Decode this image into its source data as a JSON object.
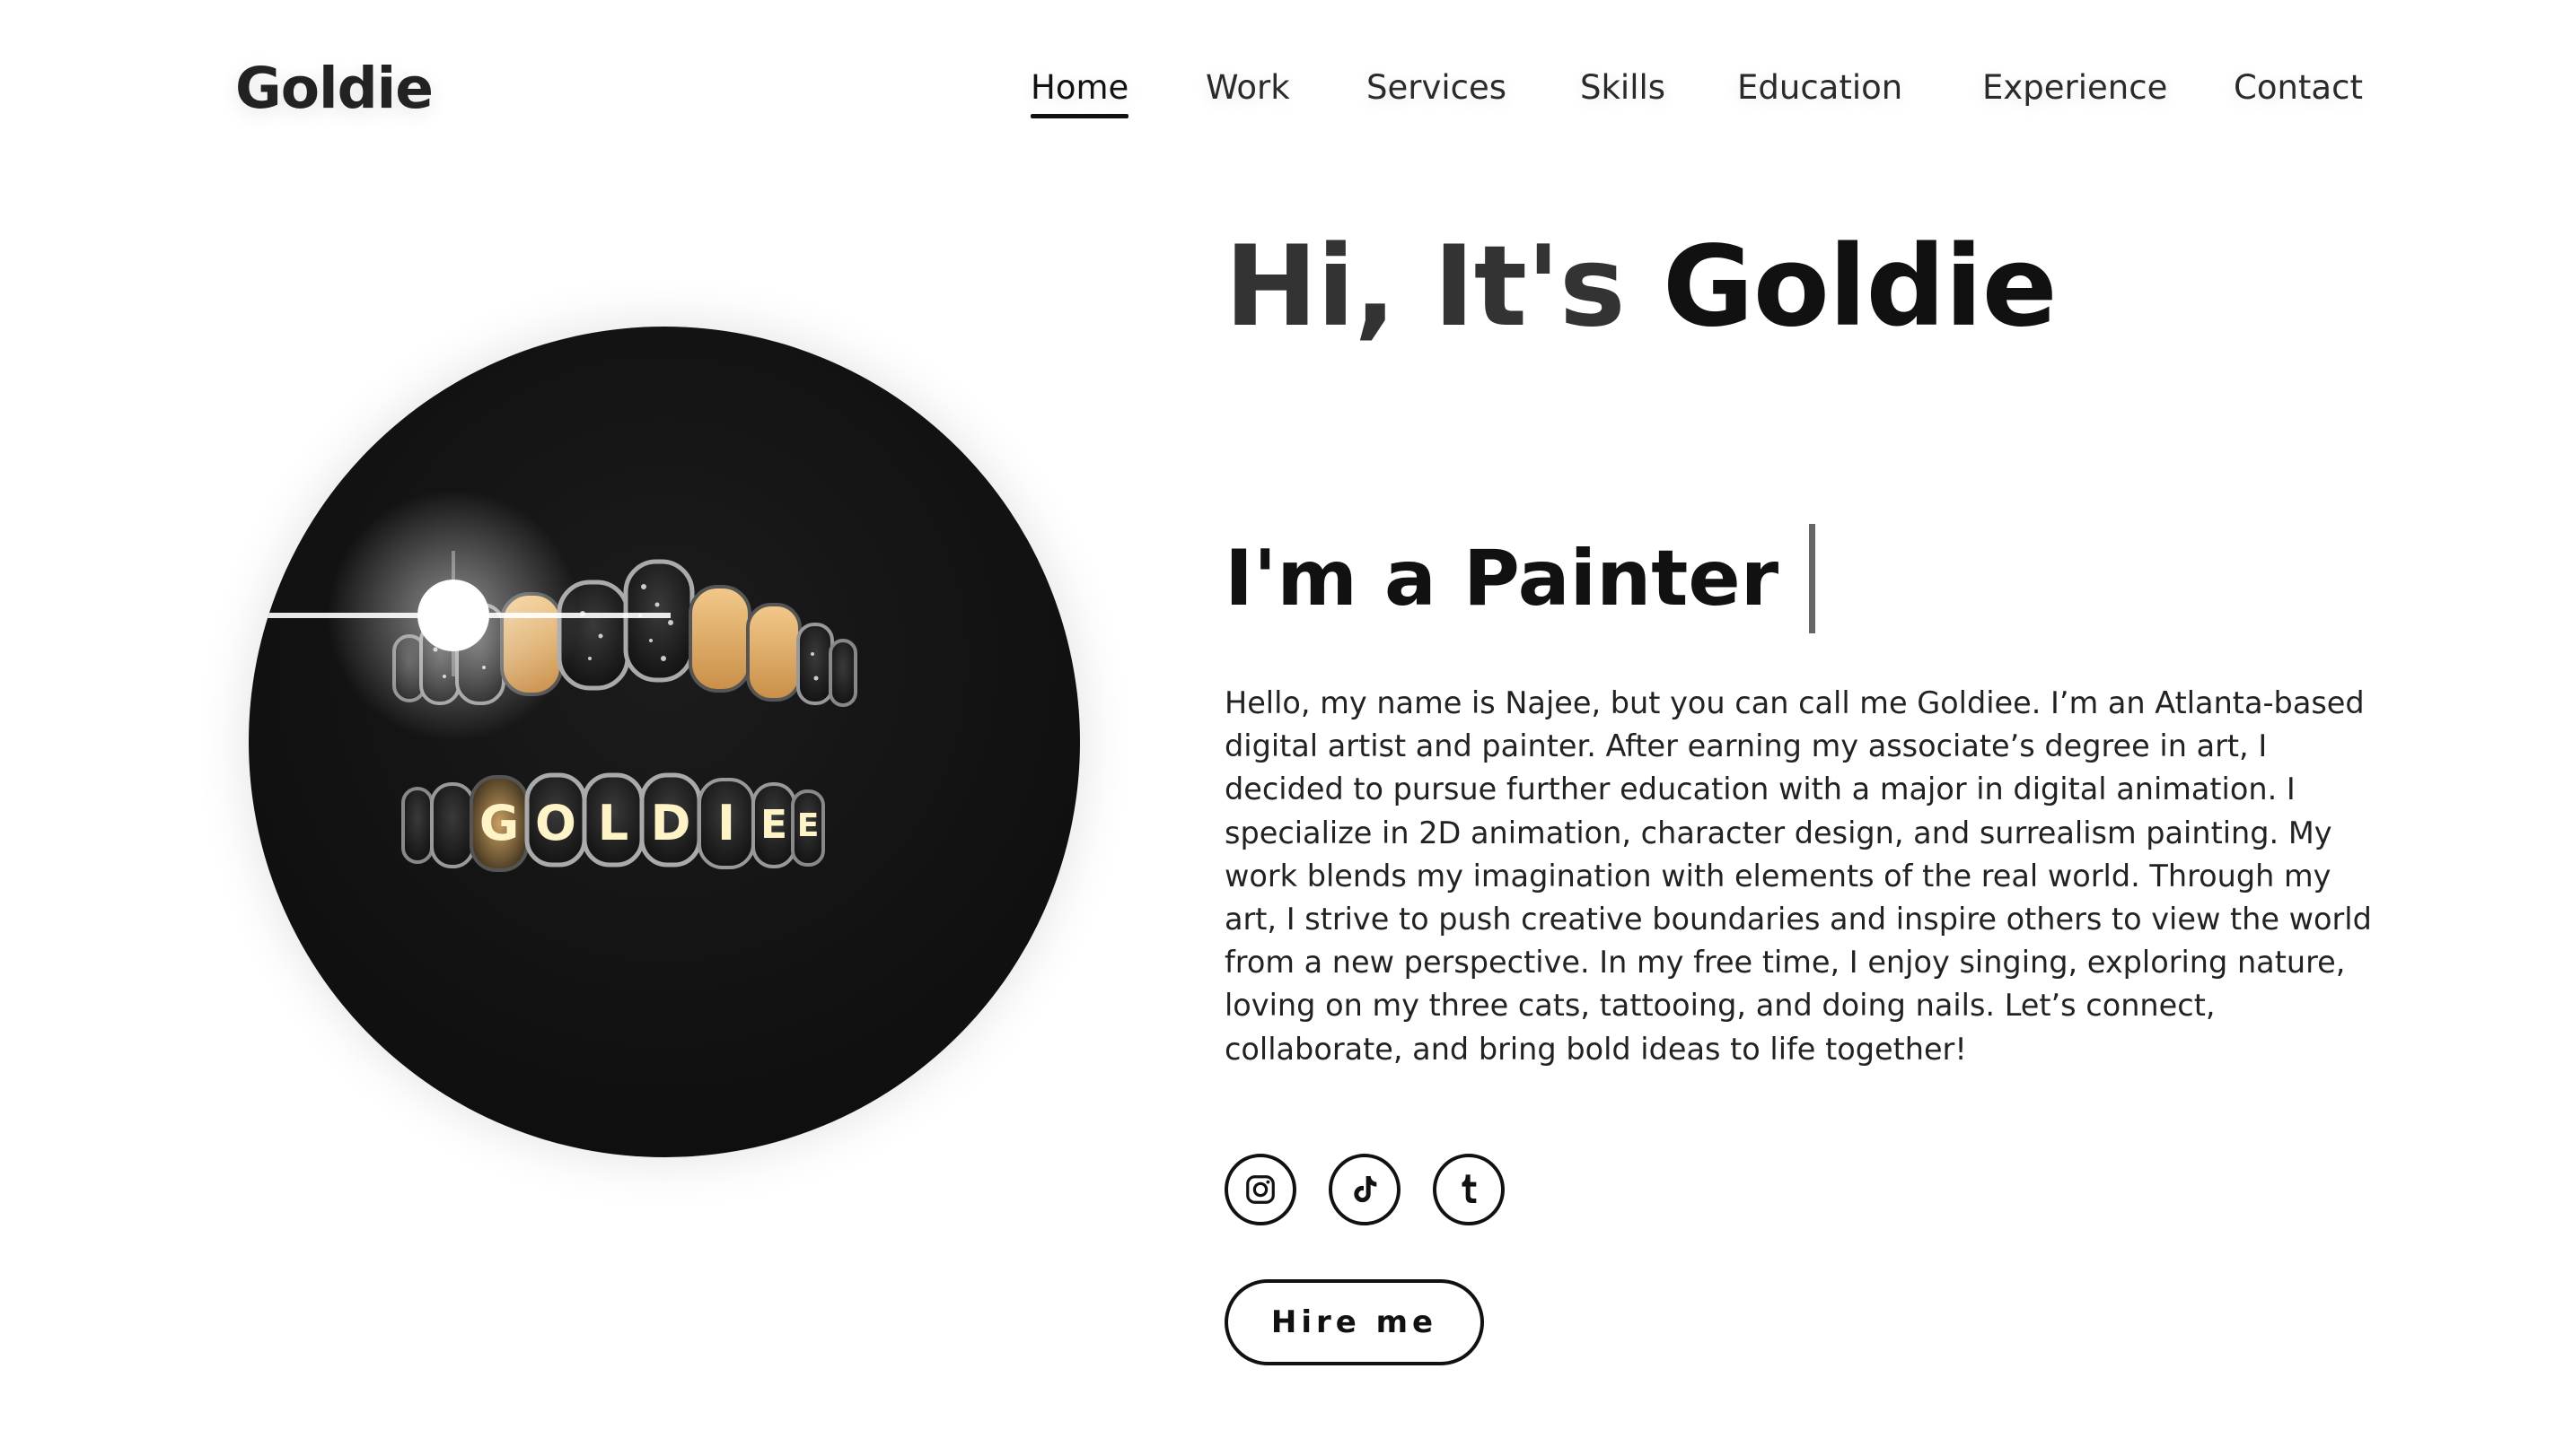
{
  "header": {
    "logo": "Goldie",
    "nav": [
      {
        "label": "Home",
        "active": true
      },
      {
        "label": "Work",
        "active": false
      },
      {
        "label": "Services",
        "active": false
      },
      {
        "label": "Skills",
        "active": false
      },
      {
        "label": "Education",
        "active": false
      },
      {
        "label": "Experience",
        "active": false
      },
      {
        "label": "Contact",
        "active": false
      }
    ]
  },
  "hero": {
    "greeting_prefix": "Hi, It's ",
    "greeting_name": "Goldie",
    "role_text": "I'm a Painter",
    "bio": "Hello, my name is Najee, but you can call me Goldiee. I’m an Atlanta-based digital artist and painter. After earning my associate’s degree in art, I decided to pursue further education with a major in digital animation. I specialize in 2D animation, character design, and surrealism painting. My work blends my imagination with elements of the real world. Through my art, I strive to push creative boundaries and inspire others to view the world from a new perspective. In my free time, I enjoy singing, exploring nature, loving on my three cats, tattooing, and doing nails. Let’s connect, collaborate, and bring bold ideas to life together!",
    "socials": [
      {
        "icon": "instagram-icon"
      },
      {
        "icon": "tiktok-icon"
      },
      {
        "icon": "tumblr-icon"
      }
    ],
    "hire_label": "Hire me",
    "portrait_lettering": "GOLDIEE"
  },
  "colors": {
    "text": "#111111",
    "background": "#ffffff",
    "gold": "#d9a865",
    "portrait_bg": "#121212"
  }
}
